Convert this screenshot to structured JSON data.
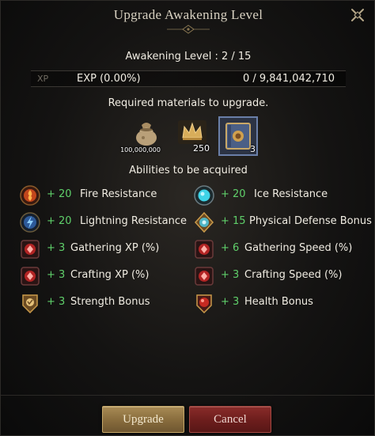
{
  "window": {
    "title": "Upgrade Awakening Level",
    "close_icon": "close-x-icon"
  },
  "progress": {
    "level_label": "Awakening Level : 2 / 15",
    "xp_tag": "XP",
    "exp_text": "EXP (0.00%)",
    "exp_total": "0 / 9,841,042,710",
    "exp_fraction": 0.0
  },
  "materials": {
    "title": "Required materials to upgrade.",
    "items": [
      {
        "icon": "silver-pouch-icon",
        "count": "100,000,000"
      },
      {
        "icon": "crown-token-icon",
        "count": "250"
      },
      {
        "icon": "blue-tome-icon",
        "count": "3"
      }
    ]
  },
  "abilities": {
    "title": "Abilities to be acquired",
    "items": [
      {
        "icon": "fire-resistance-icon",
        "value": "+ 20",
        "name": "Fire Resistance"
      },
      {
        "icon": "ice-resistance-icon",
        "value": "+ 20",
        "name": "Ice Resistance"
      },
      {
        "icon": "lightning-resistance-icon",
        "value": "+ 20",
        "name": "Lightning Resistance"
      },
      {
        "icon": "physical-defense-icon",
        "value": "+ 15",
        "name": "Physical Defense Bonus"
      },
      {
        "icon": "gathering-xp-icon",
        "value": "+ 3",
        "name": "Gathering XP (%)"
      },
      {
        "icon": "gathering-speed-icon",
        "value": "+ 6",
        "name": "Gathering Speed (%)"
      },
      {
        "icon": "crafting-xp-icon",
        "value": "+ 3",
        "name": "Crafting XP (%)"
      },
      {
        "icon": "crafting-speed-icon",
        "value": "+ 3",
        "name": "Crafting Speed (%)"
      },
      {
        "icon": "strength-bonus-icon",
        "value": "+ 3",
        "name": "Strength Bonus"
      },
      {
        "icon": "health-bonus-icon",
        "value": "+ 3",
        "name": "Health Bonus"
      }
    ]
  },
  "buttons": {
    "upgrade": "Upgrade",
    "cancel": "Cancel"
  },
  "colors": {
    "accent_green": "#5fcf6a",
    "upgrade_gold": "#8a6e3e",
    "cancel_red": "#6e1e1d"
  }
}
